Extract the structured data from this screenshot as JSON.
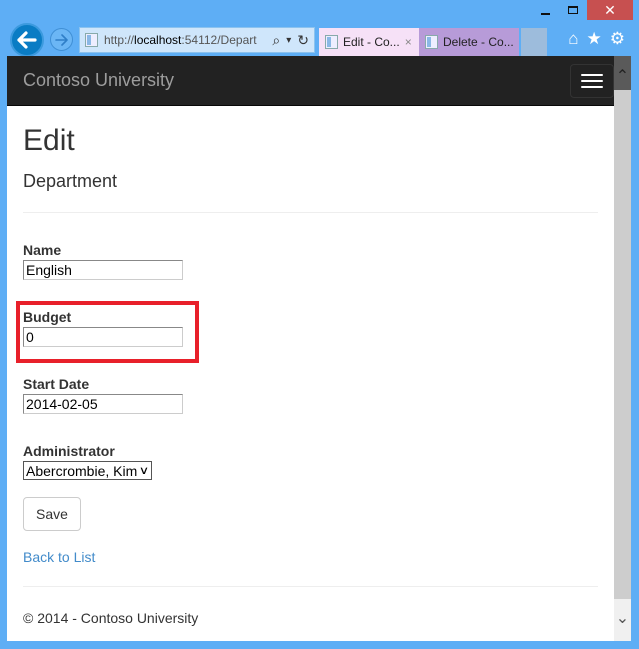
{
  "window": {
    "minimize_icon": "minimize-icon",
    "maximize_icon": "maximize-icon",
    "close_glyph": "✕"
  },
  "browser": {
    "back_glyph": "←",
    "forward_glyph": "→",
    "address": {
      "scheme": "http://",
      "host": "localhost",
      "rest": ":54112/Depart",
      "search_glyph": "⌕",
      "dropdown_glyph": "▾",
      "refresh_glyph": "↻"
    },
    "tabs": [
      {
        "label": "Edit - Co...",
        "active": true,
        "close_glyph": "×"
      },
      {
        "label": "Delete - Co...",
        "active": false
      }
    ],
    "home_glyph": "⌂",
    "favorites_glyph": "★",
    "tools_glyph": "⚙"
  },
  "navbar": {
    "brand": "Contoso University"
  },
  "page": {
    "title": "Edit",
    "subtitle": "Department",
    "fields": {
      "name": {
        "label": "Name",
        "value": "English"
      },
      "budget": {
        "label": "Budget",
        "value": "0"
      },
      "start_date": {
        "label": "Start Date",
        "value": "2014-02-05"
      },
      "administrator": {
        "label": "Administrator",
        "selected": "Abercrombie, Kim",
        "chevron": "∨"
      }
    },
    "save_label": "Save",
    "back_link": "Back to List",
    "footer": "© 2014 - Contoso University"
  },
  "scrollbar": {
    "up_glyph": "⌃",
    "down_glyph": "⌄"
  },
  "colors": {
    "highlight": "#e8202a",
    "link": "#428bca",
    "navbar": "#222222",
    "chrome": "#5eaef5"
  }
}
